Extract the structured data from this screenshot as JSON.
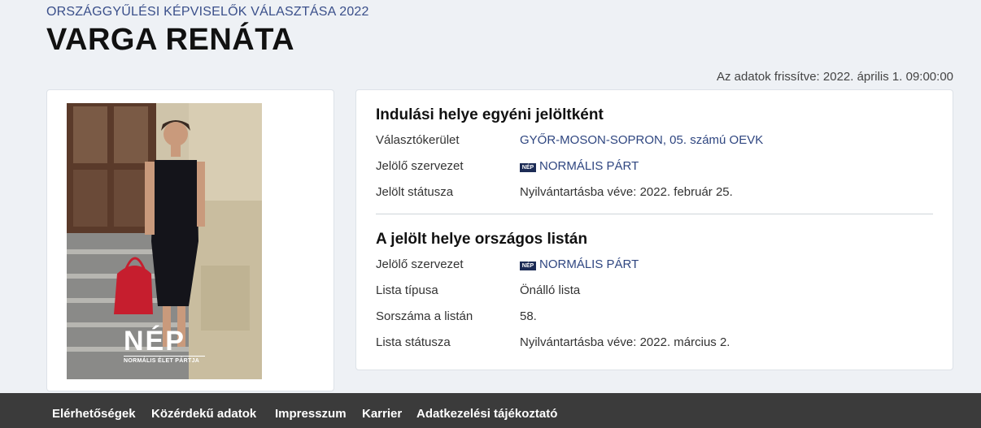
{
  "header": {
    "breadcrumb": "ORSZÁGGYŰLÉSI KÉPVISELŐK VÁLASZTÁSA 2022",
    "candidate_name": "VARGA RENÁTA",
    "updated": "Az adatok frissítve: 2022. április 1. 09:00:00"
  },
  "photo": {
    "logo_text": "NÉP",
    "logo_subtitle": "NORMÁLIS ÉLET PÁRTJA"
  },
  "individual": {
    "title": "Indulási helye egyéni jelöltként",
    "rows": [
      {
        "label": "Választókerület",
        "value": "GYŐR-MOSON-SOPRON, 05. számú OEVK"
      },
      {
        "label": "Jelölő szervezet",
        "value": "NORMÁLIS PÁRT"
      },
      {
        "label": "Jelölt státusza",
        "value": "Nyilvántartásba véve: 2022. február 25."
      }
    ]
  },
  "national_list": {
    "title": "A jelölt helye országos listán",
    "rows": [
      {
        "label": "Jelölő szervezet",
        "value": "NORMÁLIS PÁRT"
      },
      {
        "label": "Lista típusa",
        "value": "Önálló lista"
      },
      {
        "label": "Sorszáma a listán",
        "value": "58."
      },
      {
        "label": "Lista státusza",
        "value": "Nyilvántartásba véve: 2022. március 2."
      }
    ]
  },
  "party_icon_text": "NÉP",
  "footer": {
    "links": [
      "Elérhetőségek",
      "Közérdekű adatok",
      "Impresszum",
      "Karrier",
      "Adatkezelési tájékoztató"
    ]
  }
}
